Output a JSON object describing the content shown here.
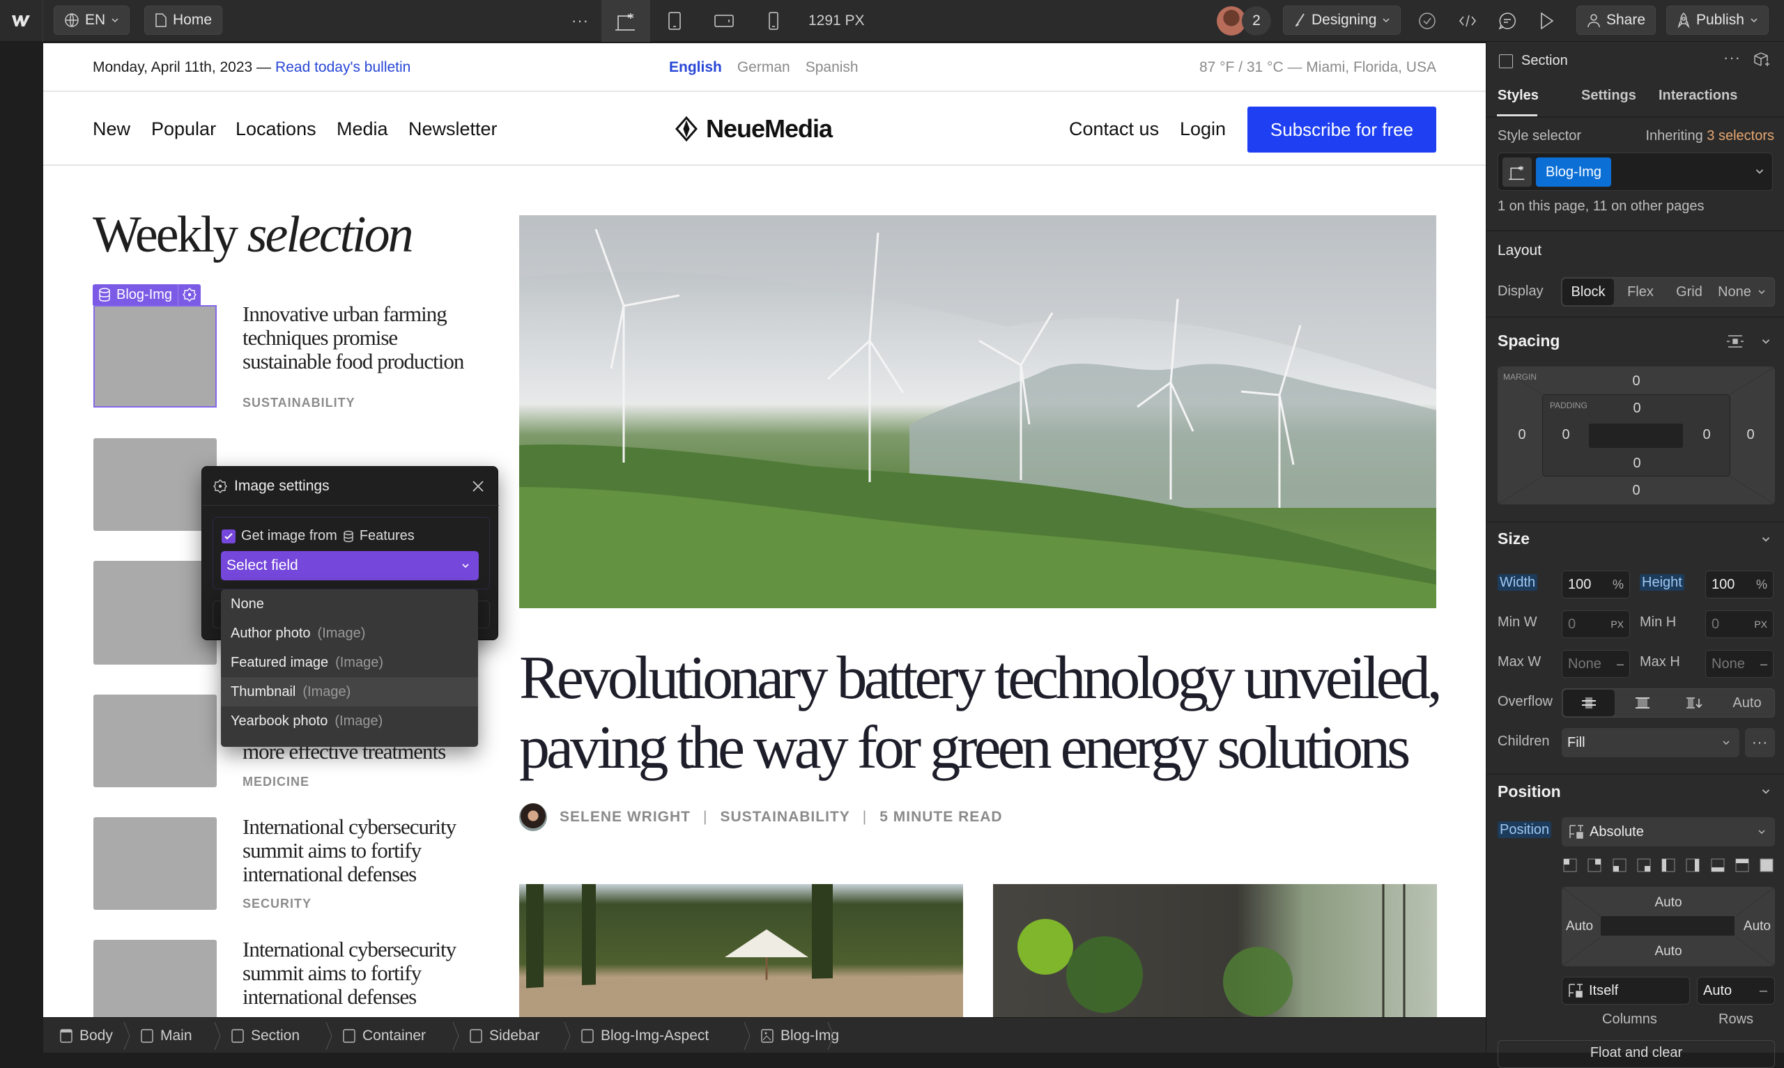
{
  "topbar": {
    "locale": "EN",
    "page": "Home",
    "more": "···",
    "width_readout": "1291 PX",
    "collaborator_count": "2",
    "mode": "Designing",
    "share": "Share",
    "publish": "Publish"
  },
  "canvas": {
    "dateline": "Monday, April 11th, 2023 —",
    "bulletin_link": "Read today's bulletin",
    "languages": [
      "English",
      "German",
      "Spanish"
    ],
    "weather": "87 °F / 31 °C — Miami, Florida, USA",
    "nav": [
      "New",
      "Popular",
      "Locations",
      "Media",
      "Newsletter"
    ],
    "logo": "NeueMedia",
    "contact": "Contact us",
    "login": "Login",
    "subscribe": "Subscribe for free",
    "section_title_plain": "Weekly",
    "section_title_italic": "selection",
    "selected_badge": "Blog-Img",
    "articles": [
      {
        "title": "Innovative urban farming techniques promise sustainable food production",
        "category": "SUSTAINABILITY"
      },
      {
        "title": "",
        "category": ""
      },
      {
        "title": "",
        "category": ""
      },
      {
        "title": "Breakthrough in cancer research offers hope for more effective treatments",
        "category": "MEDICINE"
      },
      {
        "title": "International cybersecurity summit aims to fortify international defenses",
        "category": "SECURITY"
      },
      {
        "title": "International cybersecurity summit aims to fortify international defenses",
        "category": ""
      }
    ],
    "feature": {
      "headline": "Revolutionary battery technology unveiled, paving the way for green energy solutions",
      "author": "SELENE WRIGHT",
      "category": "SUSTAINABILITY",
      "read_time": "5 MINUTE READ"
    }
  },
  "image_settings": {
    "title": "Image settings",
    "checkbox_label": "Get image from",
    "checked": true,
    "collection": "Features",
    "select_placeholder": "Select field",
    "options": [
      {
        "label": "None",
        "hint": ""
      },
      {
        "label": "Author photo",
        "hint": "(Image)"
      },
      {
        "label": "Featured image",
        "hint": "(Image)"
      },
      {
        "label": "Thumbnail",
        "hint": "(Image)",
        "hovered": true
      },
      {
        "label": "Yearbook photo",
        "hint": "(Image)"
      }
    ]
  },
  "panel": {
    "element": "Section",
    "tabs": [
      "Styles",
      "Settings",
      "Interactions"
    ],
    "active_tab": "Styles",
    "style_selector_label": "Style selector",
    "inheriting_prefix": "Inheriting",
    "inheriting_count": "3 selectors",
    "selector_class": "Blog-Img",
    "selector_usage": "1 on this page, 11 on other pages",
    "layout": {
      "title": "Layout",
      "display_label": "Display",
      "options": [
        "Block",
        "Flex",
        "Grid",
        "None"
      ],
      "active": "Block"
    },
    "spacing": {
      "title": "Spacing",
      "margin_label": "MARGIN",
      "padding_label": "PADDING",
      "margin": {
        "top": "0",
        "right": "0",
        "bottom": "0",
        "left": "0"
      },
      "padding": {
        "top": "0",
        "right": "0",
        "bottom": "0",
        "left": "0"
      }
    },
    "size": {
      "title": "Size",
      "width_label": "Width",
      "width": "100",
      "width_unit": "%",
      "height_label": "Height",
      "height": "100",
      "height_unit": "%",
      "minw_label": "Min W",
      "minw": "0",
      "minw_unit": "PX",
      "minh_label": "Min H",
      "minh": "0",
      "minh_unit": "PX",
      "maxw_label": "Max W",
      "maxw": "None",
      "maxw_unit": "–",
      "maxh_label": "Max H",
      "maxh": "None",
      "maxh_unit": "–",
      "overflow_label": "Overflow",
      "overflow_auto": "Auto",
      "children_label": "Children",
      "children": "Fill",
      "more": "···"
    },
    "position": {
      "title": "Position",
      "label": "Position",
      "value": "Absolute",
      "offsets": {
        "top": "Auto",
        "right": "Auto",
        "bottom": "Auto",
        "left": "Auto"
      },
      "relative_to": "Itself",
      "z": "Auto",
      "z_unit": "–",
      "columns": "Columns",
      "rows": "Rows",
      "float_clear": "Float and clear"
    }
  },
  "breadcrumbs": [
    "Body",
    "Main",
    "Section",
    "Container",
    "Sidebar",
    "Blog-Img-Aspect",
    "Blog-Img"
  ],
  "colors": {
    "accent_blue": "#1f3ff2",
    "link_blue": "#2746d6",
    "purple": "#7547db",
    "selector_blue": "#0b6fd6",
    "inherit_orange": "#e8a871"
  }
}
